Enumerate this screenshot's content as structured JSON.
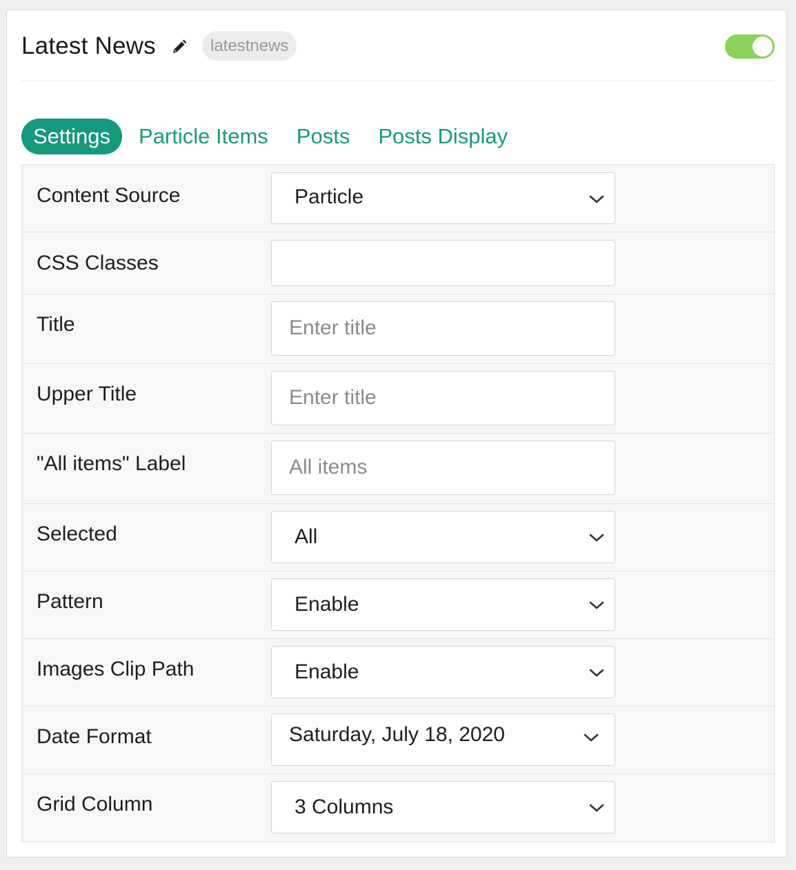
{
  "header": {
    "title": "Latest News",
    "slug": "latestnews",
    "enabled": true,
    "colors": {
      "toggle_on": "#8ad35a",
      "accent": "#15997c"
    }
  },
  "tabs": [
    {
      "label": "Settings",
      "active": true
    },
    {
      "label": "Particle Items",
      "active": false
    },
    {
      "label": "Posts",
      "active": false
    },
    {
      "label": "Posts Display",
      "active": false
    }
  ],
  "form": {
    "content_source": {
      "label": "Content Source",
      "value": "Particle"
    },
    "css_classes": {
      "label": "CSS Classes",
      "value": ""
    },
    "title": {
      "label": "Title",
      "placeholder": "Enter title"
    },
    "upper_title": {
      "label": "Upper Title",
      "placeholder": "Enter title"
    },
    "all_items_label": {
      "label": "\"All items\" Label",
      "placeholder": "All items"
    },
    "selected": {
      "label": "Selected",
      "value": "All"
    },
    "pattern": {
      "label": "Pattern",
      "value": "Enable"
    },
    "images_clip_path": {
      "label": "Images Clip Path",
      "value": "Enable"
    },
    "date_format": {
      "label": "Date Format",
      "value": "Saturday, July 18, 2020"
    },
    "grid_column": {
      "label": "Grid Column",
      "value": "3 Columns"
    }
  },
  "icons": {
    "edit": "pencil-icon",
    "dropdown": "chevron-down-icon"
  }
}
